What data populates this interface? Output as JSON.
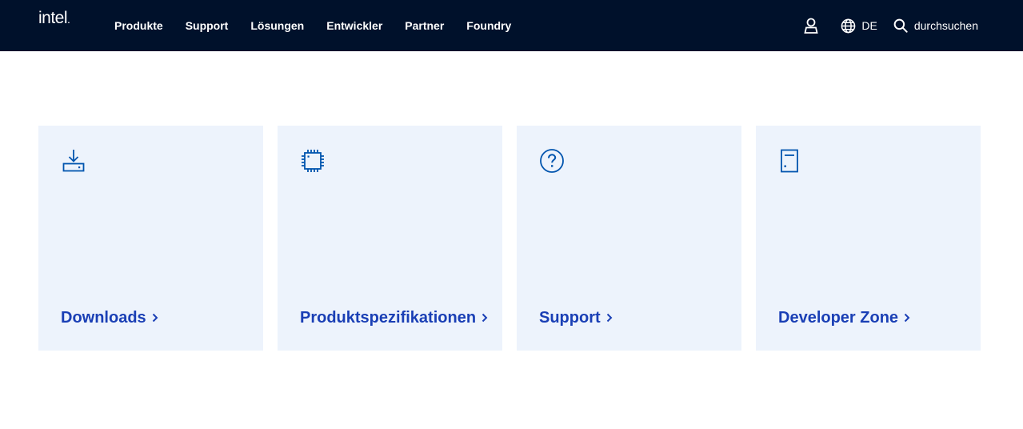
{
  "header": {
    "logo": "intel",
    "nav": [
      "Produkte",
      "Support",
      "Lösungen",
      "Entwickler",
      "Partner",
      "Foundry"
    ],
    "language": "DE",
    "search_label": "durchsuchen",
    "account_icon": "user-icon",
    "language_icon": "globe-icon",
    "search_icon": "search-icon"
  },
  "cards": [
    {
      "label": "Downloads",
      "icon": "download-icon"
    },
    {
      "label": "Produktspezifikationen",
      "icon": "chip-icon"
    },
    {
      "label": "Support",
      "icon": "help-icon"
    },
    {
      "label": "Developer Zone",
      "icon": "document-icon"
    }
  ],
  "colors": {
    "header_bg": "#00112b",
    "card_bg": "#edf3fc",
    "accent": "#1a3fb5",
    "icon_blue": "#0054ae"
  }
}
